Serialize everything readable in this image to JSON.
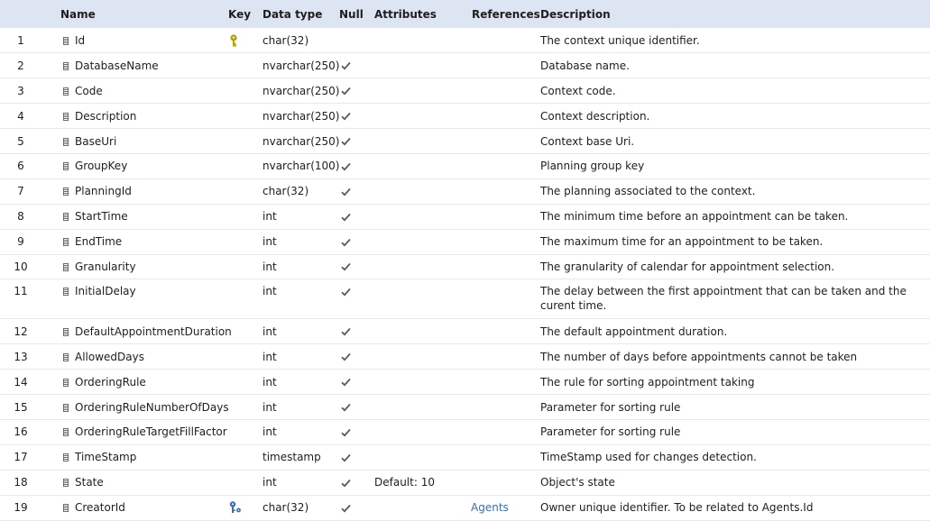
{
  "headers": {
    "num": "",
    "name": "Name",
    "key": "Key",
    "type": "Data type",
    "null": "Null",
    "attributes": "Attributes",
    "references": "References",
    "description": "Description"
  },
  "colors": {
    "header_bg": "#dde5f2",
    "primary_key_icon": "#b5a20a",
    "foreign_key_icon": "#3a6fb0",
    "reference_link": "#3a6fb0"
  },
  "rows": [
    {
      "num": "1",
      "name": "Id",
      "key": "primary-key-icon",
      "type": "char(32)",
      "null": false,
      "attributes": "",
      "references": "",
      "description": "The context unique identifier."
    },
    {
      "num": "2",
      "name": "DatabaseName",
      "key": "",
      "type": "nvarchar(250)",
      "null": true,
      "attributes": "",
      "references": "",
      "description": "Database name."
    },
    {
      "num": "3",
      "name": "Code",
      "key": "",
      "type": "nvarchar(250)",
      "null": true,
      "attributes": "",
      "references": "",
      "description": "Context code."
    },
    {
      "num": "4",
      "name": "Description",
      "key": "",
      "type": "nvarchar(250)",
      "null": true,
      "attributes": "",
      "references": "",
      "description": "Context description."
    },
    {
      "num": "5",
      "name": "BaseUri",
      "key": "",
      "type": "nvarchar(250)",
      "null": true,
      "attributes": "",
      "references": "",
      "description": "Context base Uri."
    },
    {
      "num": "6",
      "name": "GroupKey",
      "key": "",
      "type": "nvarchar(100)",
      "null": true,
      "attributes": "",
      "references": "",
      "description": "Planning group key"
    },
    {
      "num": "7",
      "name": "PlanningId",
      "key": "",
      "type": "char(32)",
      "null": true,
      "attributes": "",
      "references": "",
      "description": "The planning associated to the context."
    },
    {
      "num": "8",
      "name": "StartTime",
      "key": "",
      "type": "int",
      "null": true,
      "attributes": "",
      "references": "",
      "description": "The minimum time before an appointment can be taken."
    },
    {
      "num": "9",
      "name": "EndTime",
      "key": "",
      "type": "int",
      "null": true,
      "attributes": "",
      "references": "",
      "description": "The maximum time for an appointment to be taken."
    },
    {
      "num": "10",
      "name": "Granularity",
      "key": "",
      "type": "int",
      "null": true,
      "attributes": "",
      "references": "",
      "description": "The granularity of calendar for appointment selection."
    },
    {
      "num": "11",
      "name": "InitialDelay",
      "key": "",
      "type": "int",
      "null": true,
      "attributes": "",
      "references": "",
      "description": "The delay between the first appointment that can be taken and the curent time."
    },
    {
      "num": "12",
      "name": "DefaultAppointmentDuration",
      "key": "",
      "type": "int",
      "null": true,
      "attributes": "",
      "references": "",
      "description": "The default appointment duration."
    },
    {
      "num": "13",
      "name": "AllowedDays",
      "key": "",
      "type": "int",
      "null": true,
      "attributes": "",
      "references": "",
      "description": "The number of days before appointments cannot be taken"
    },
    {
      "num": "14",
      "name": "OrderingRule",
      "key": "",
      "type": "int",
      "null": true,
      "attributes": "",
      "references": "",
      "description": "The rule for sorting appointment taking"
    },
    {
      "num": "15",
      "name": "OrderingRuleNumberOfDays",
      "key": "",
      "type": "int",
      "null": true,
      "attributes": "",
      "references": "",
      "description": "Parameter for sorting rule"
    },
    {
      "num": "16",
      "name": "OrderingRuleTargetFillFactor",
      "key": "",
      "type": "int",
      "null": true,
      "attributes": "",
      "references": "",
      "description": "Parameter for sorting rule"
    },
    {
      "num": "17",
      "name": "TimeStamp",
      "key": "",
      "type": "timestamp",
      "null": true,
      "attributes": "",
      "references": "",
      "description": "TimeStamp used for changes detection."
    },
    {
      "num": "18",
      "name": "State",
      "key": "",
      "type": "int",
      "null": true,
      "attributes": "Default: 10",
      "references": "",
      "description": "Object's state"
    },
    {
      "num": "19",
      "name": "CreatorId",
      "key": "foreign-key-icon",
      "type": "char(32)",
      "null": true,
      "attributes": "",
      "references": "Agents",
      "description": "Owner unique identifier. To be related to Agents.Id"
    }
  ]
}
